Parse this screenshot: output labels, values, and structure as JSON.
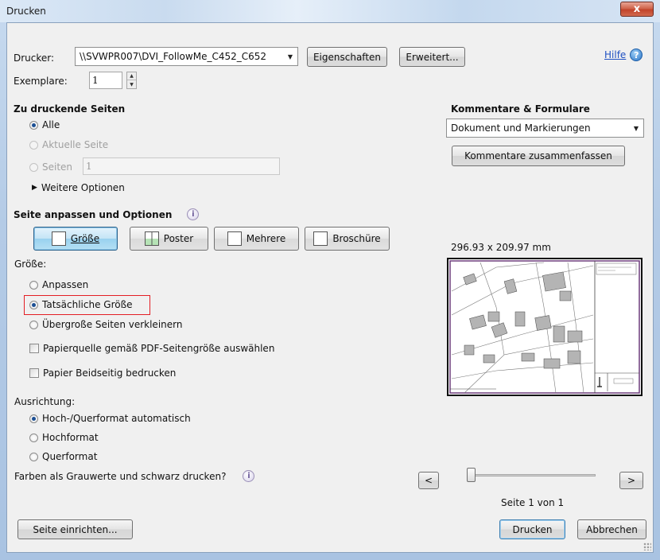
{
  "window": {
    "title": "Drucken",
    "close_glyph": "x"
  },
  "printer": {
    "label": "Drucker:",
    "selected": "\\\\SVWPR007\\DVI_FollowMe_C452_C652",
    "properties_button": "Eigenschaften",
    "advanced_button": "Erweitert...",
    "help_link": "Hilfe"
  },
  "copies": {
    "label": "Exemplare:",
    "value": "1"
  },
  "pages_section": {
    "heading": "Zu druckende Seiten",
    "all_label": "Alle",
    "current_page_label": "Aktuelle Seite",
    "pages_label": "Seiten",
    "pages_value": "1",
    "more_options_label": "Weitere Optionen"
  },
  "comments": {
    "heading": "Kommentare & Formulare",
    "selected": "Dokument und Markierungen",
    "summarize_button": "Kommentare zusammenfassen"
  },
  "fit_section": {
    "heading": "Seite anpassen und Optionen",
    "tabs": [
      {
        "label": "Größe",
        "active": true,
        "icon": "page-size-icon"
      },
      {
        "label": "Poster",
        "active": false,
        "icon": "poster-icon"
      },
      {
        "label": "Mehrere",
        "active": false,
        "icon": "multiple-pages-icon"
      },
      {
        "label": "Broschüre",
        "active": false,
        "icon": "booklet-icon"
      }
    ],
    "size_label": "Größe:",
    "fit_label": "Anpassen",
    "actual_size_label": "Tatsächliche Größe",
    "shrink_label": "Übergroße Seiten verkleinern",
    "paper_source_label": "Papierquelle gemäß PDF-Seitengröße auswählen",
    "duplex_label": "Papier Beidseitig bedrucken"
  },
  "orientation": {
    "label": "Ausrichtung:",
    "auto_label": "Hoch-/Querformat automatisch",
    "portrait_label": "Hochformat",
    "landscape_label": "Querformat"
  },
  "grayscale_label": "Farben als Grauwerte und schwarz drucken?",
  "preview": {
    "dimensions": "296.93 x 209.97 mm",
    "page_indicator": "Seite 1 von 1",
    "prev_glyph": "<",
    "next_glyph": ">"
  },
  "footer": {
    "page_setup_button": "Seite einrichten...",
    "print_button": "Drucken",
    "cancel_button": "Abbrechen"
  }
}
